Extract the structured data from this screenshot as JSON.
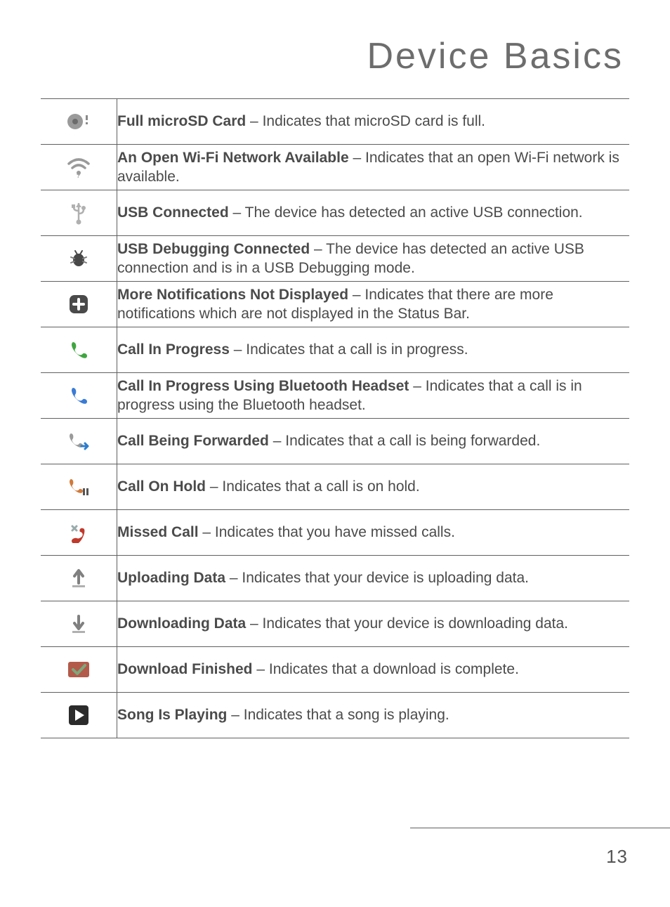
{
  "page_title": "Device Basics",
  "page_number": "13",
  "rows": [
    {
      "title": "Full microSD Card",
      "desc": "Indicates that microSD card is full."
    },
    {
      "title": "An Open Wi-Fi Network Available",
      "desc": "Indicates that an open Wi-Fi network is available."
    },
    {
      "title": "USB Connected",
      "desc": "The device has detected an active USB connection."
    },
    {
      "title": "USB Debugging Connected",
      "desc": "The device has detected an active USB connection and is in a USB Debugging mode."
    },
    {
      "title": "More Notifications Not Displayed",
      "desc": "Indicates that there are more notifications which are not displayed in the Status Bar."
    },
    {
      "title": "Call In Progress",
      "desc": "Indicates that a call is in progress."
    },
    {
      "title": "Call In Progress Using Bluetooth Headset",
      "desc": "Indicates that a call is in progress using the Bluetooth headset."
    },
    {
      "title": "Call Being Forwarded",
      "desc": "Indicates that a call is being forwarded."
    },
    {
      "title": "Call On Hold",
      "desc": "Indicates that a call is on hold."
    },
    {
      "title": "Missed Call",
      "desc": "Indicates that you have missed calls."
    },
    {
      "title": "Uploading Data",
      "desc": "Indicates that your device is uploading data."
    },
    {
      "title": "Downloading Data",
      "desc": "Indicates that your device is downloading data."
    },
    {
      "title": "Download Finished",
      "desc": "Indicates that a download is complete."
    },
    {
      "title": "Song Is Playing",
      "desc": "Indicates that a song is playing."
    }
  ]
}
